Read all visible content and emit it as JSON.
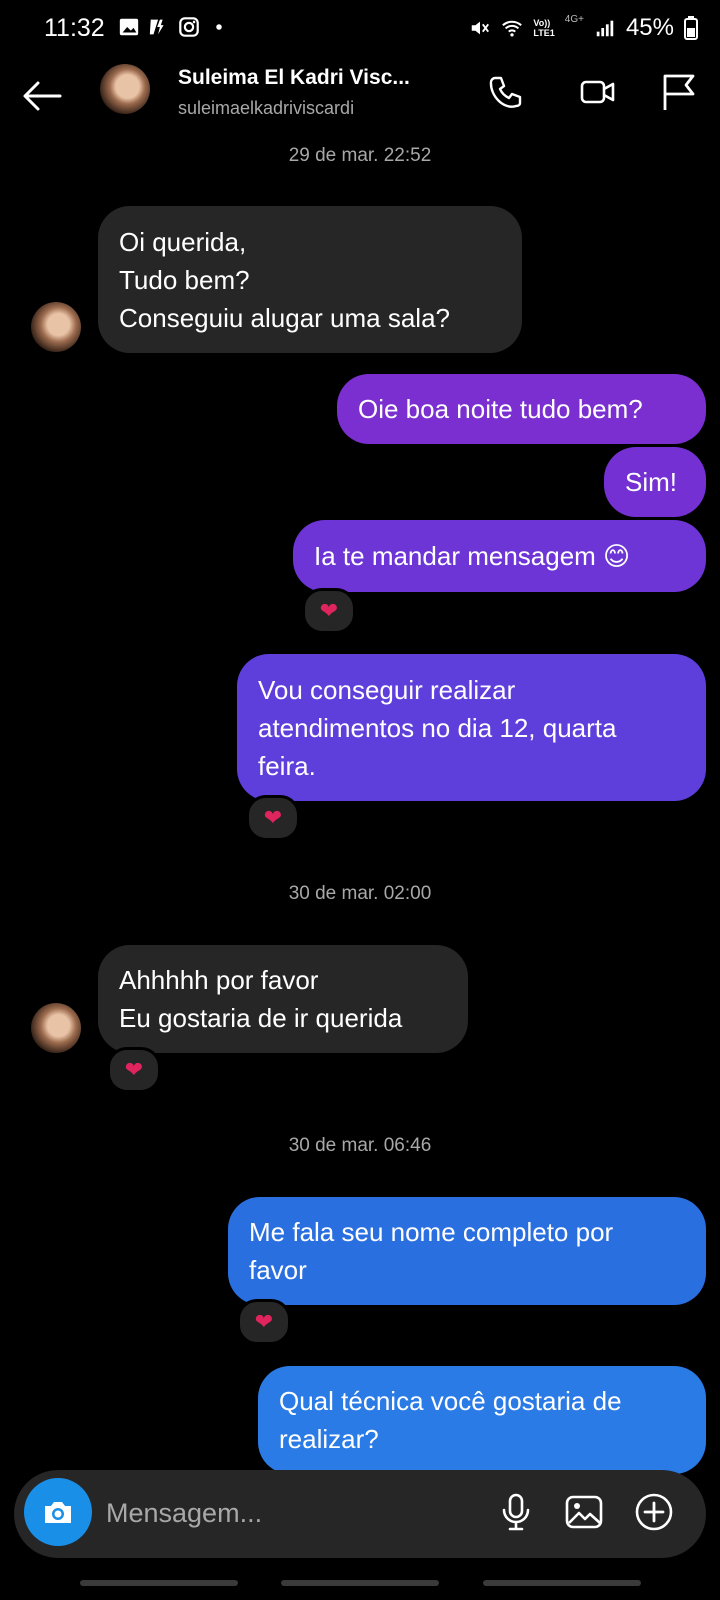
{
  "status_bar": {
    "time": "11:32",
    "battery": "45%",
    "network": "LTE1",
    "network_top": "Vo))",
    "gen": "4G+"
  },
  "header": {
    "name": "Suleima El Kadri Visc...",
    "username": "suleimaelkadriviscardi",
    "icons": [
      "back-arrow-icon",
      "phone-icon",
      "video-icon",
      "flag-icon"
    ]
  },
  "timestamps": [
    "29 de mar. 22:52",
    "30 de mar. 02:00",
    "30 de mar. 06:46"
  ],
  "messages": [
    {
      "from": "them",
      "lines": [
        "Oi querida,",
        "Tudo bem?",
        "Conseguiu alugar uma sala?"
      ]
    },
    {
      "from": "me",
      "lines": [
        "Oie boa noite tudo bem?"
      ]
    },
    {
      "from": "me",
      "lines": [
        "Sim!"
      ]
    },
    {
      "from": "me",
      "lines": [
        "Ia te mandar mensagem 😊"
      ],
      "reaction": "❤"
    },
    {
      "from": "me",
      "lines": [
        "Vou conseguir realizar",
        "atendimentos no dia 12, quarta",
        "feira."
      ],
      "reaction": "❤"
    },
    {
      "from": "them",
      "lines": [
        "Ahhhhh por favor",
        "Eu gostaria de ir querida"
      ],
      "reaction": "❤"
    },
    {
      "from": "me",
      "lines": [
        "Me fala seu nome completo por",
        "favor"
      ],
      "reaction": "❤"
    },
    {
      "from": "me",
      "lines": [
        "Qual técnica você gostaria de",
        "realizar?"
      ]
    }
  ],
  "composer": {
    "placeholder": "Mensagem..."
  },
  "colors": {
    "incoming": "#262626",
    "purple": "#7b2fd0",
    "indigo": "#5f3fdc",
    "blue": "#2a7be6",
    "brand_blue": "#1a8fe8"
  }
}
